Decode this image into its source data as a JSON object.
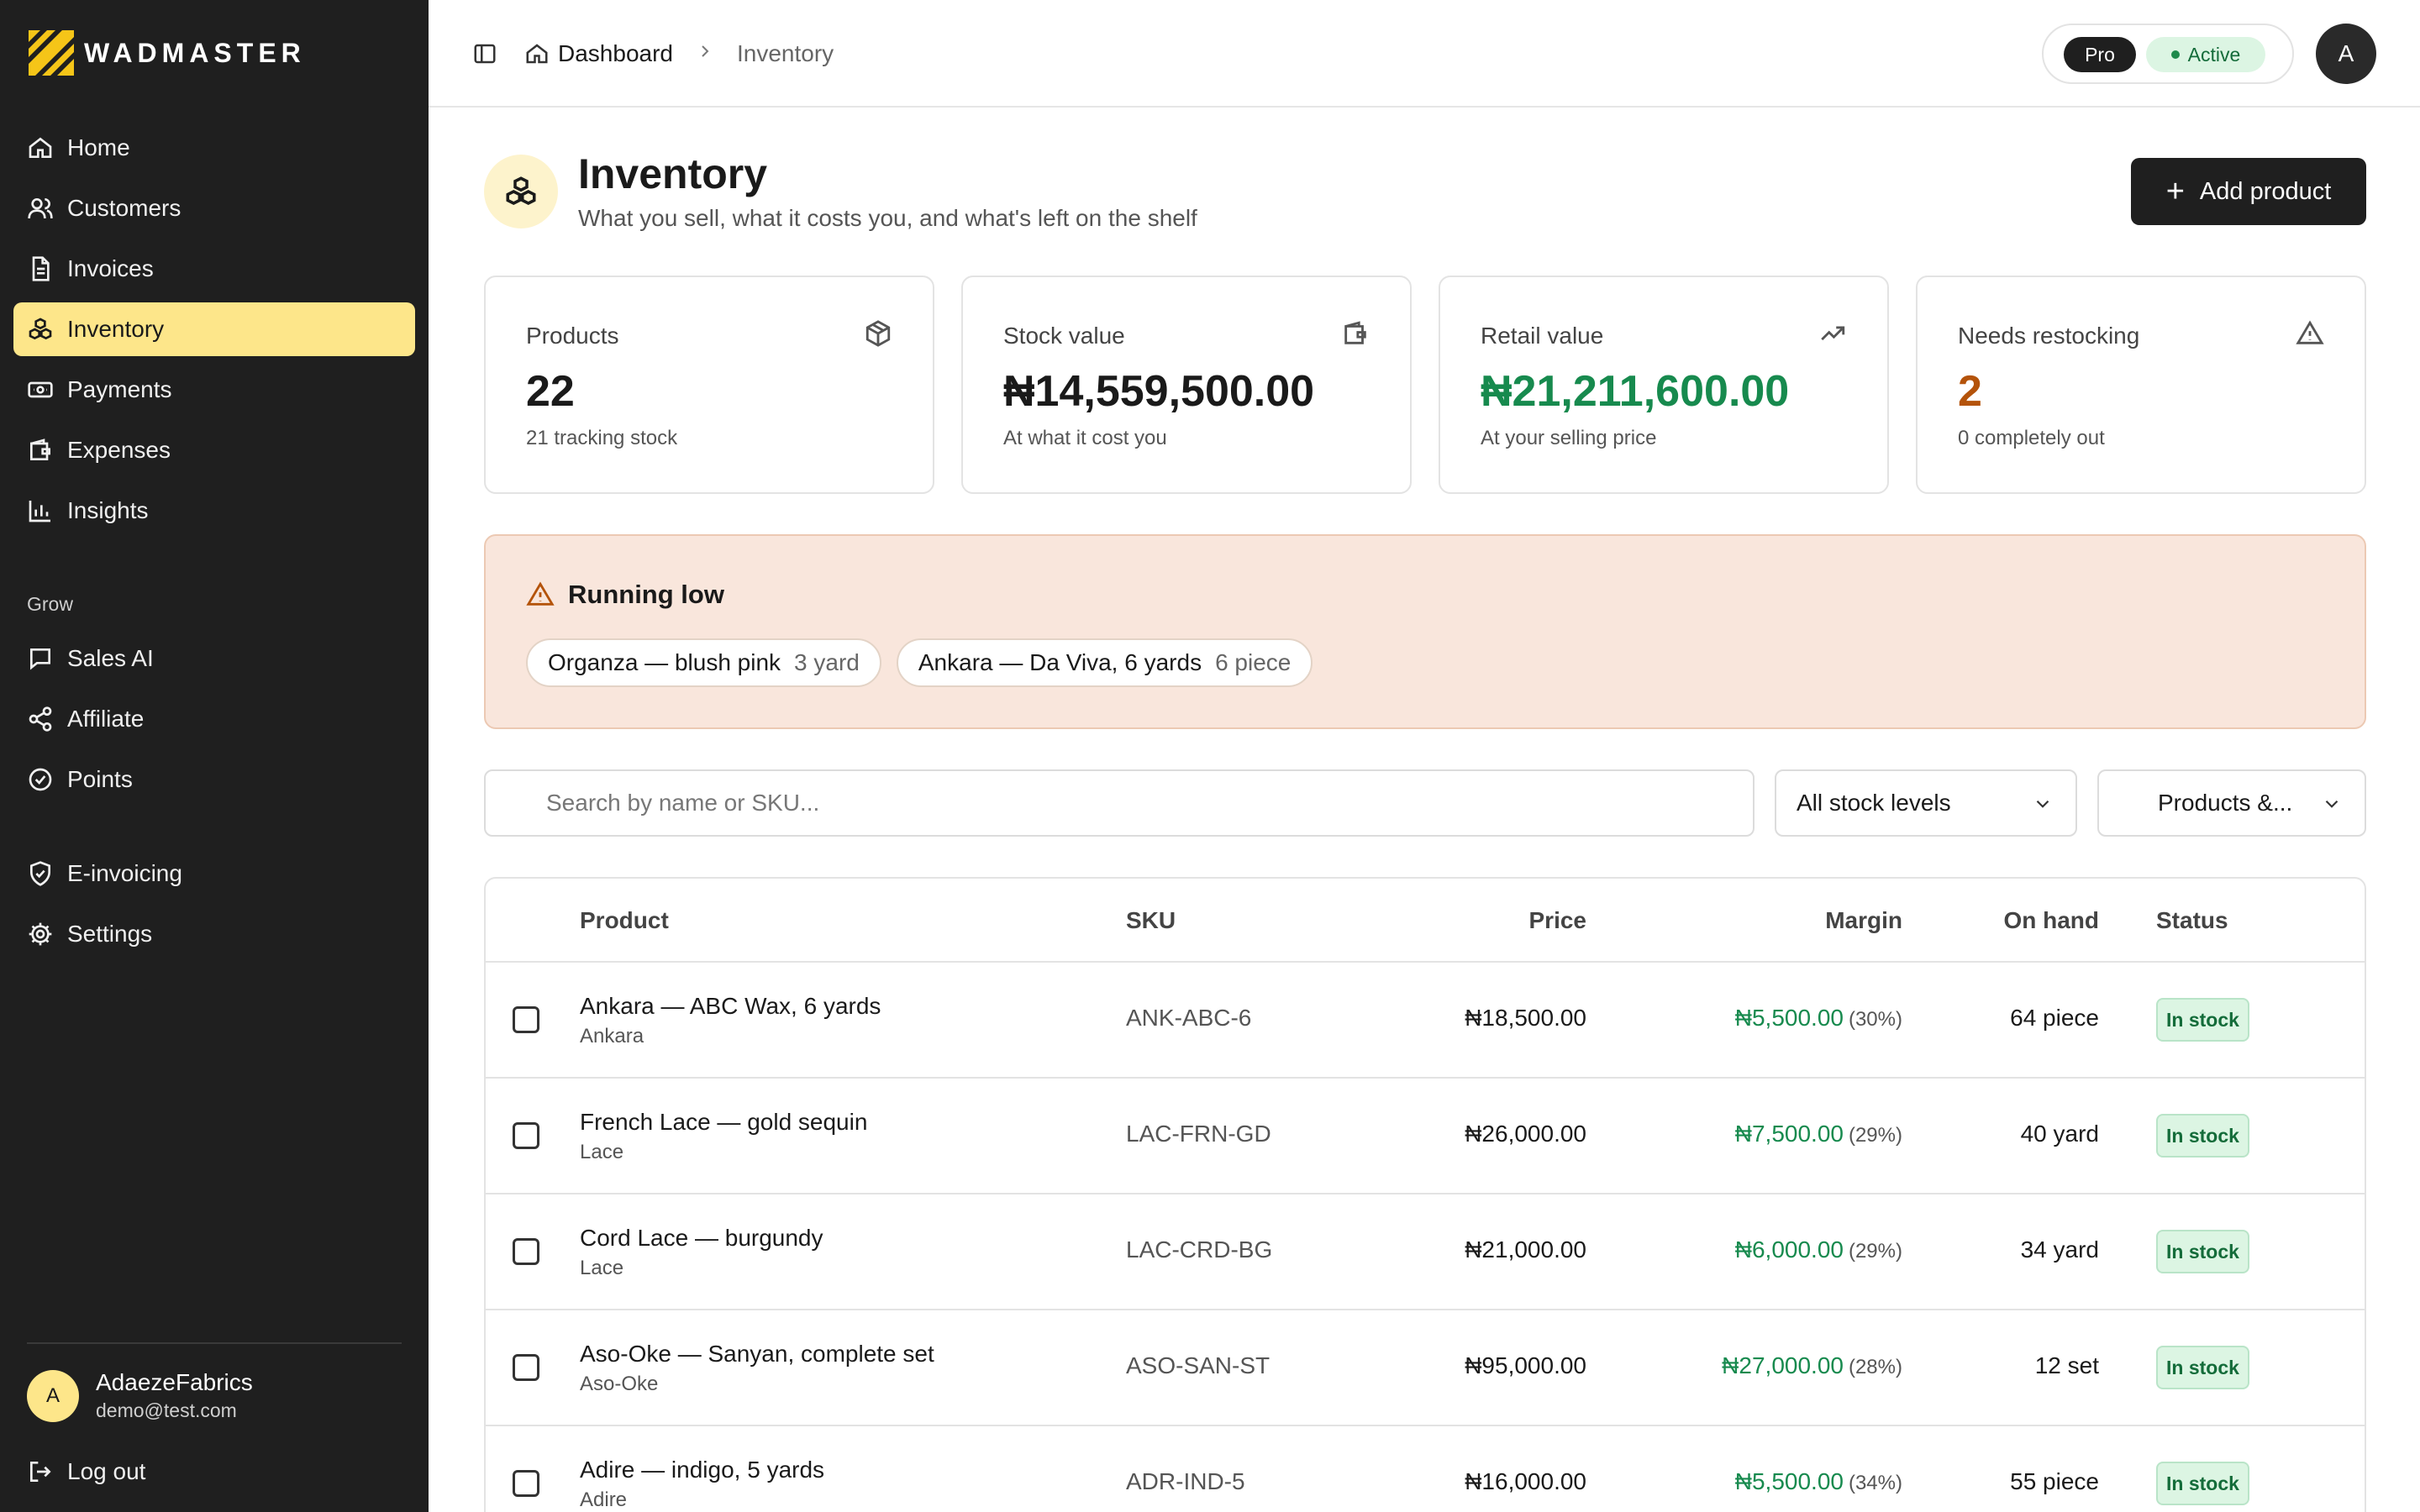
{
  "brand": {
    "name": "WADMASTER"
  },
  "sidebar": {
    "items": [
      {
        "label": "Home",
        "icon": "home-icon"
      },
      {
        "label": "Customers",
        "icon": "users-icon"
      },
      {
        "label": "Invoices",
        "icon": "document-icon"
      },
      {
        "label": "Inventory",
        "icon": "inventory-icon",
        "active": true
      },
      {
        "label": "Payments",
        "icon": "banknote-icon"
      },
      {
        "label": "Expenses",
        "icon": "wallet-icon"
      },
      {
        "label": "Insights",
        "icon": "bar-chart-icon"
      }
    ],
    "grow_section": "Grow",
    "grow_items": [
      {
        "label": "Sales AI",
        "icon": "chat-icon"
      },
      {
        "label": "Affiliate",
        "icon": "share-icon"
      },
      {
        "label": "Points",
        "icon": "check-circle-icon"
      }
    ],
    "bottom_items": [
      {
        "label": "E-invoicing",
        "icon": "shield-check-icon"
      },
      {
        "label": "Settings",
        "icon": "gear-icon"
      }
    ],
    "user": {
      "initial": "A",
      "name": "AdaezeFabrics",
      "email": "demo@test.com"
    },
    "logout_label": "Log out"
  },
  "topbar": {
    "breadcrumb": {
      "home": "Dashboard",
      "current": "Inventory"
    },
    "plan": "Pro",
    "status": "Active",
    "avatar_initial": "A"
  },
  "header": {
    "title": "Inventory",
    "subtitle": "What you sell, what it costs you, and what's left on the shelf",
    "add_button": "Add product"
  },
  "stats": [
    {
      "label": "Products",
      "value": "22",
      "note": "21 tracking stock",
      "icon": "box-icon",
      "color": "#1a1a1a"
    },
    {
      "label": "Stock value",
      "value": "₦14,559,500.00",
      "note": "At what it cost you",
      "icon": "wallet-icon",
      "color": "#1a1a1a"
    },
    {
      "label": "Retail value",
      "value": "₦21,211,600.00",
      "note": "At your selling price",
      "icon": "trending-up-icon",
      "color": "#178a4e"
    },
    {
      "label": "Needs restocking",
      "value": "2",
      "note": "0 completely out",
      "icon": "warning-icon",
      "color": "#b4530a"
    }
  ],
  "running_low": {
    "title": "Running low",
    "items": [
      {
        "name": "Organza — blush pink",
        "qty": "3 yard"
      },
      {
        "name": "Ankara — Da Viva, 6 yards",
        "qty": "6 piece"
      }
    ]
  },
  "filters": {
    "search_placeholder": "Search by name or SKU...",
    "stock_level": "All stock levels",
    "type": "Products &..."
  },
  "table": {
    "columns": {
      "product": "Product",
      "sku": "SKU",
      "price": "Price",
      "margin": "Margin",
      "on_hand": "On hand",
      "status": "Status"
    },
    "rows": [
      {
        "name": "Ankara — ABC Wax, 6 yards",
        "category": "Ankara",
        "sku": "ANK-ABC-6",
        "price": "₦18,500.00",
        "margin": "₦5,500.00",
        "margin_pct": "(30%)",
        "on_hand": "64 piece",
        "status": "In stock"
      },
      {
        "name": "French Lace — gold sequin",
        "category": "Lace",
        "sku": "LAC-FRN-GD",
        "price": "₦26,000.00",
        "margin": "₦7,500.00",
        "margin_pct": "(29%)",
        "on_hand": "40 yard",
        "status": "In stock"
      },
      {
        "name": "Cord Lace — burgundy",
        "category": "Lace",
        "sku": "LAC-CRD-BG",
        "price": "₦21,000.00",
        "margin": "₦6,000.00",
        "margin_pct": "(29%)",
        "on_hand": "34 yard",
        "status": "In stock"
      },
      {
        "name": "Aso-Oke — Sanyan, complete set",
        "category": "Aso-Oke",
        "sku": "ASO-SAN-ST",
        "price": "₦95,000.00",
        "margin": "₦27,000.00",
        "margin_pct": "(28%)",
        "on_hand": "12 set",
        "status": "In stock"
      },
      {
        "name": "Adire — indigo, 5 yards",
        "category": "Adire",
        "sku": "ADR-IND-5",
        "price": "₦16,000.00",
        "margin": "₦5,500.00",
        "margin_pct": "(34%)",
        "on_hand": "55 piece",
        "status": "In stock"
      }
    ]
  },
  "colors": {
    "accent": "#fde68a",
    "sidebar": "#1f1f1f",
    "success": "#178a4e",
    "warning": "#b4530a"
  }
}
